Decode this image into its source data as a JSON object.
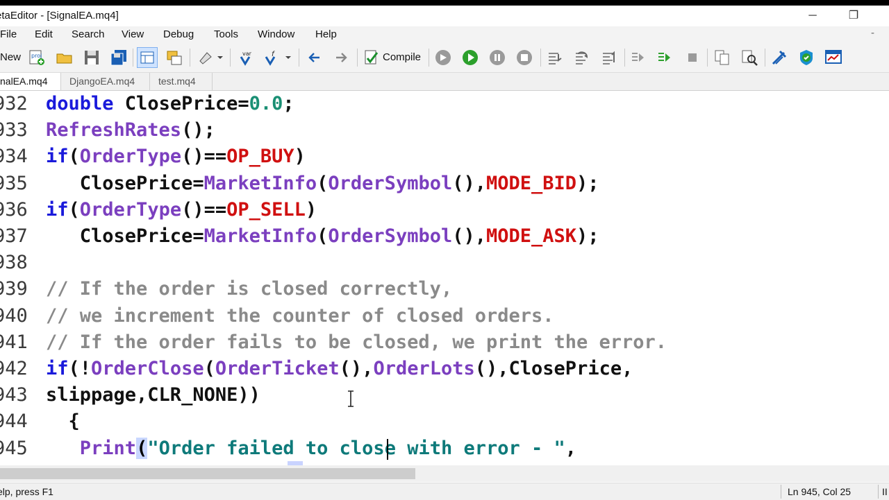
{
  "window": {
    "title": "etaEditor - [SignalEA.mq4]",
    "minimize_glyph": "─",
    "restore_glyph": "❐",
    "mdi_minimize_glyph": "-"
  },
  "menu": [
    "File",
    "Edit",
    "Search",
    "View",
    "Debug",
    "Tools",
    "Window",
    "Help"
  ],
  "toolbar": {
    "new_label": "New",
    "compile_label": "Compile",
    "icons": [
      "new-icon",
      "open-folder-icon",
      "save-icon",
      "save-all-icon",
      "navigator-icon",
      "toolbox-icon",
      "styler-icon",
      "var-list-icon",
      "function-list-icon",
      "back-arrow-icon",
      "forward-arrow-icon",
      "compile-icon",
      "start-debug-icon",
      "play-icon",
      "pause-icon",
      "stop-icon",
      "step-into-icon",
      "step-over-icon",
      "step-out-icon",
      "start-profiling-icon",
      "profiling-run-icon",
      "profiling-stop-icon",
      "copy-icon",
      "find-icon",
      "strategy-tester-icon",
      "vps-icon",
      "terminal-icon"
    ]
  },
  "tabs": [
    {
      "label": "nalEA.mq4",
      "active": true
    },
    {
      "label": "DjangoEA.mq4",
      "active": false
    },
    {
      "label": "test.mq4",
      "active": false
    }
  ],
  "code_lines": [
    {
      "n": "932",
      "segments": [
        [
          "kw",
          "double"
        ],
        [
          "pl",
          " ClosePrice="
        ],
        [
          "num",
          "0.0"
        ],
        [
          "pl",
          ";"
        ]
      ]
    },
    {
      "n": "933",
      "segments": [
        [
          "fn",
          "RefreshRates"
        ],
        [
          "pl",
          "();"
        ]
      ]
    },
    {
      "n": "934",
      "segments": [
        [
          "kw",
          "if"
        ],
        [
          "pl",
          "("
        ],
        [
          "fn",
          "OrderType"
        ],
        [
          "pl",
          "()=="
        ],
        [
          "cn",
          "OP_BUY"
        ],
        [
          "pl",
          ")"
        ]
      ]
    },
    {
      "n": "935",
      "segments": [
        [
          "pl",
          "   ClosePrice="
        ],
        [
          "fn",
          "MarketInfo"
        ],
        [
          "pl",
          "("
        ],
        [
          "fn",
          "OrderSymbol"
        ],
        [
          "pl",
          "(),"
        ],
        [
          "cn",
          "MODE_BID"
        ],
        [
          "pl",
          ");"
        ]
      ]
    },
    {
      "n": "936",
      "segments": [
        [
          "kw",
          "if"
        ],
        [
          "pl",
          "("
        ],
        [
          "fn",
          "OrderType"
        ],
        [
          "pl",
          "()=="
        ],
        [
          "cn",
          "OP_SELL"
        ],
        [
          "pl",
          ")"
        ]
      ]
    },
    {
      "n": "937",
      "segments": [
        [
          "pl",
          "   ClosePrice="
        ],
        [
          "fn",
          "MarketInfo"
        ],
        [
          "pl",
          "("
        ],
        [
          "fn",
          "OrderSymbol"
        ],
        [
          "pl",
          "(),"
        ],
        [
          "cn",
          "MODE_ASK"
        ],
        [
          "pl",
          ");"
        ]
      ]
    },
    {
      "n": "938",
      "segments": []
    },
    {
      "n": "939",
      "segments": [
        [
          "cm",
          "// If the order is closed correctly,"
        ]
      ]
    },
    {
      "n": "940",
      "segments": [
        [
          "cm",
          "// we increment the counter of closed orders."
        ]
      ]
    },
    {
      "n": "941",
      "segments": [
        [
          "cm",
          "// If the order fails to be closed, we print the error."
        ]
      ]
    },
    {
      "n": "942",
      "segments": [
        [
          "kw",
          "if"
        ],
        [
          "pl",
          "(!"
        ],
        [
          "fn",
          "OrderClose"
        ],
        [
          "pl",
          "("
        ],
        [
          "fn",
          "OrderTicket"
        ],
        [
          "pl",
          "(),"
        ],
        [
          "fn",
          "OrderLots"
        ],
        [
          "pl",
          "(),ClosePrice,"
        ]
      ]
    },
    {
      "n": "943",
      "segments": [
        [
          "pl",
          "slippage,CLR_NONE))"
        ]
      ]
    },
    {
      "n": "944",
      "segments": [
        [
          "pl",
          "  {"
        ]
      ]
    },
    {
      "n": "945",
      "segments": [
        [
          "pl",
          "   "
        ],
        [
          "fn",
          "Print"
        ],
        [
          "br",
          "("
        ],
        [
          "str",
          "\"Order failed to close with error - \""
        ],
        [
          "pl",
          ","
        ]
      ]
    }
  ],
  "colors": {
    "keyword": "#1a1adb",
    "function": "#7b3fbf",
    "constant": "#d01010",
    "number": "#1a8f74",
    "comment": "#8a8a8a",
    "string": "#0e7a7a"
  },
  "status": {
    "help": "elp, press F1",
    "position": "Ln 945, Col 25",
    "mode": "II"
  }
}
